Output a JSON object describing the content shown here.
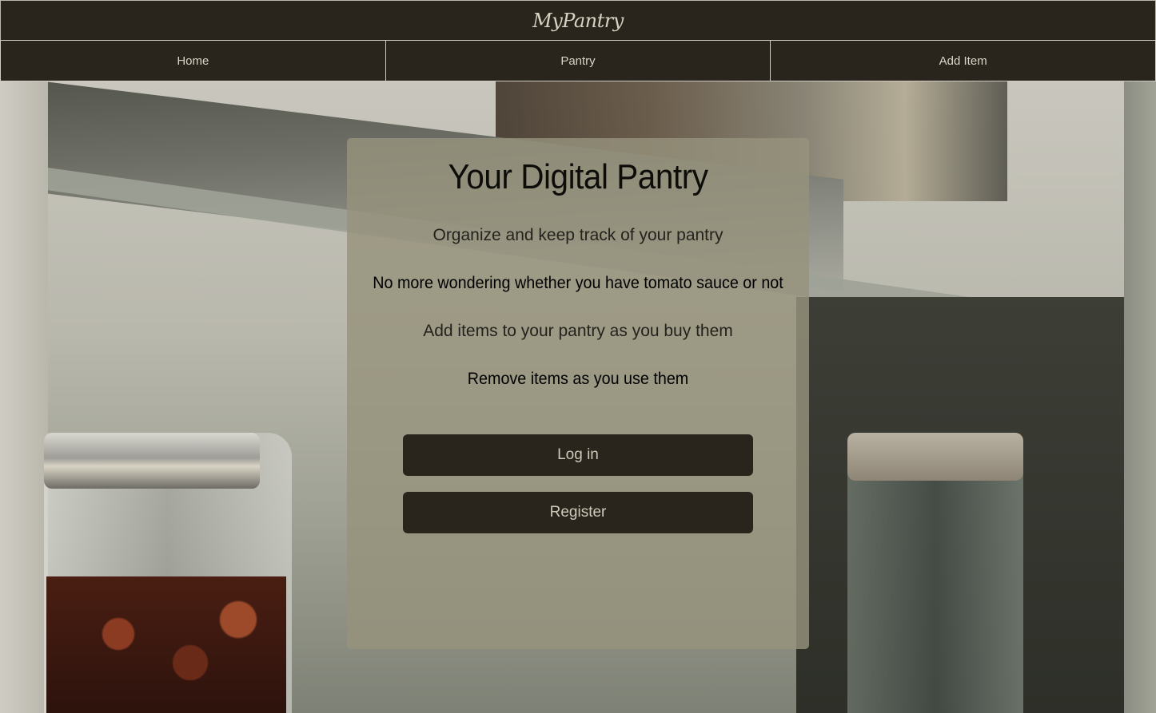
{
  "header": {
    "logo_text": "MyPantry"
  },
  "nav": {
    "items": [
      {
        "label": "Home"
      },
      {
        "label": "Pantry"
      },
      {
        "label": "Add Item"
      }
    ]
  },
  "card": {
    "title": "Your Digital Pantry",
    "line1": "Organize and keep track of your pantry",
    "line2": "No more wondering whether you have tomato sauce or not",
    "line3": "Add items to your pantry as you buy them",
    "line4": "Remove items as you use them",
    "login_label": "Log in",
    "register_label": "Register"
  },
  "colors": {
    "header_bg": "#2a251c",
    "button_bg": "#2a251c",
    "card_bg": "#96927d"
  }
}
